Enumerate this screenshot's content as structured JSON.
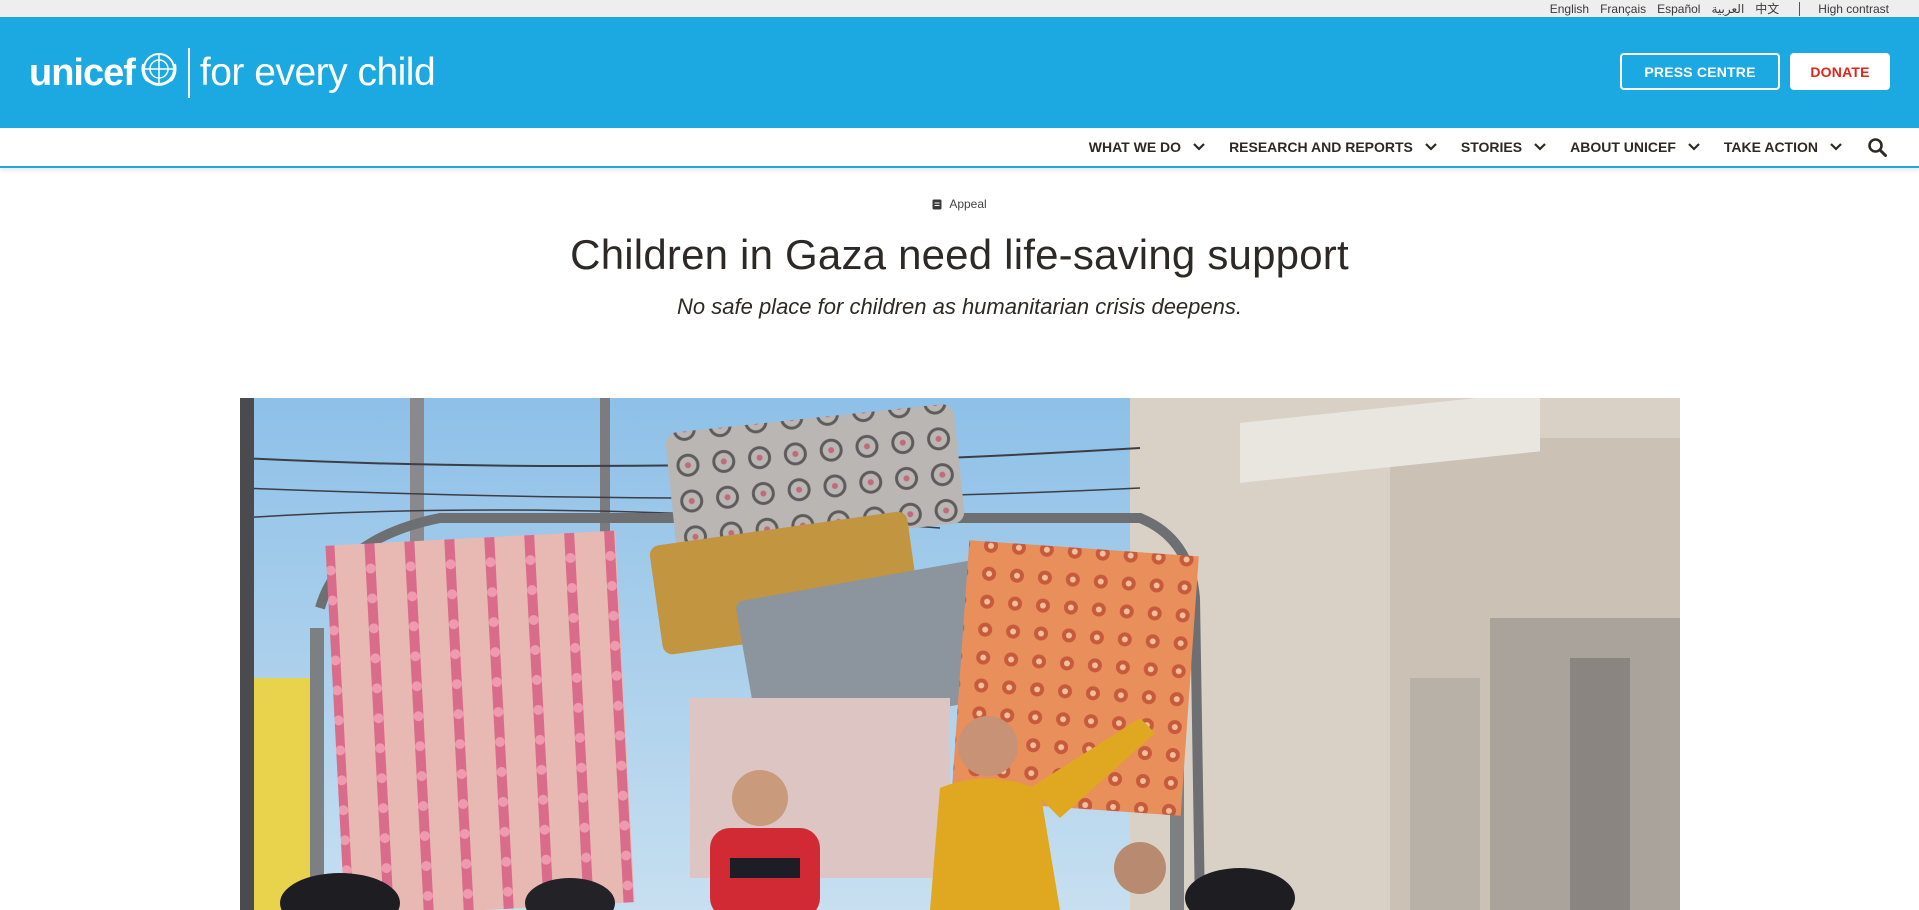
{
  "utility": {
    "languages": [
      "English",
      "Français",
      "Español",
      "العربية",
      "中文"
    ],
    "high_contrast": "High contrast"
  },
  "header": {
    "logo_word": "unicef",
    "tagline": "for every child",
    "press_label": "PRESS CENTRE",
    "donate_label": "DONATE",
    "brand_color": "#1ca9e1",
    "donate_text_color": "#e2231a"
  },
  "nav": {
    "items": [
      {
        "label": "WHAT WE DO",
        "icon": "chevron-down-icon"
      },
      {
        "label": "RESEARCH AND REPORTS",
        "icon": "chevron-down-icon"
      },
      {
        "label": "STORIES",
        "icon": "chevron-down-icon"
      },
      {
        "label": "ABOUT UNICEF",
        "icon": "chevron-down-icon"
      },
      {
        "label": "TAKE ACTION",
        "icon": "chevron-down-icon"
      }
    ],
    "search_icon": "search-icon"
  },
  "article": {
    "tag": "Appeal",
    "title": "Children in Gaza need life-saving support",
    "subtitle": "No safe place for children as humanitarian crisis deepens."
  }
}
